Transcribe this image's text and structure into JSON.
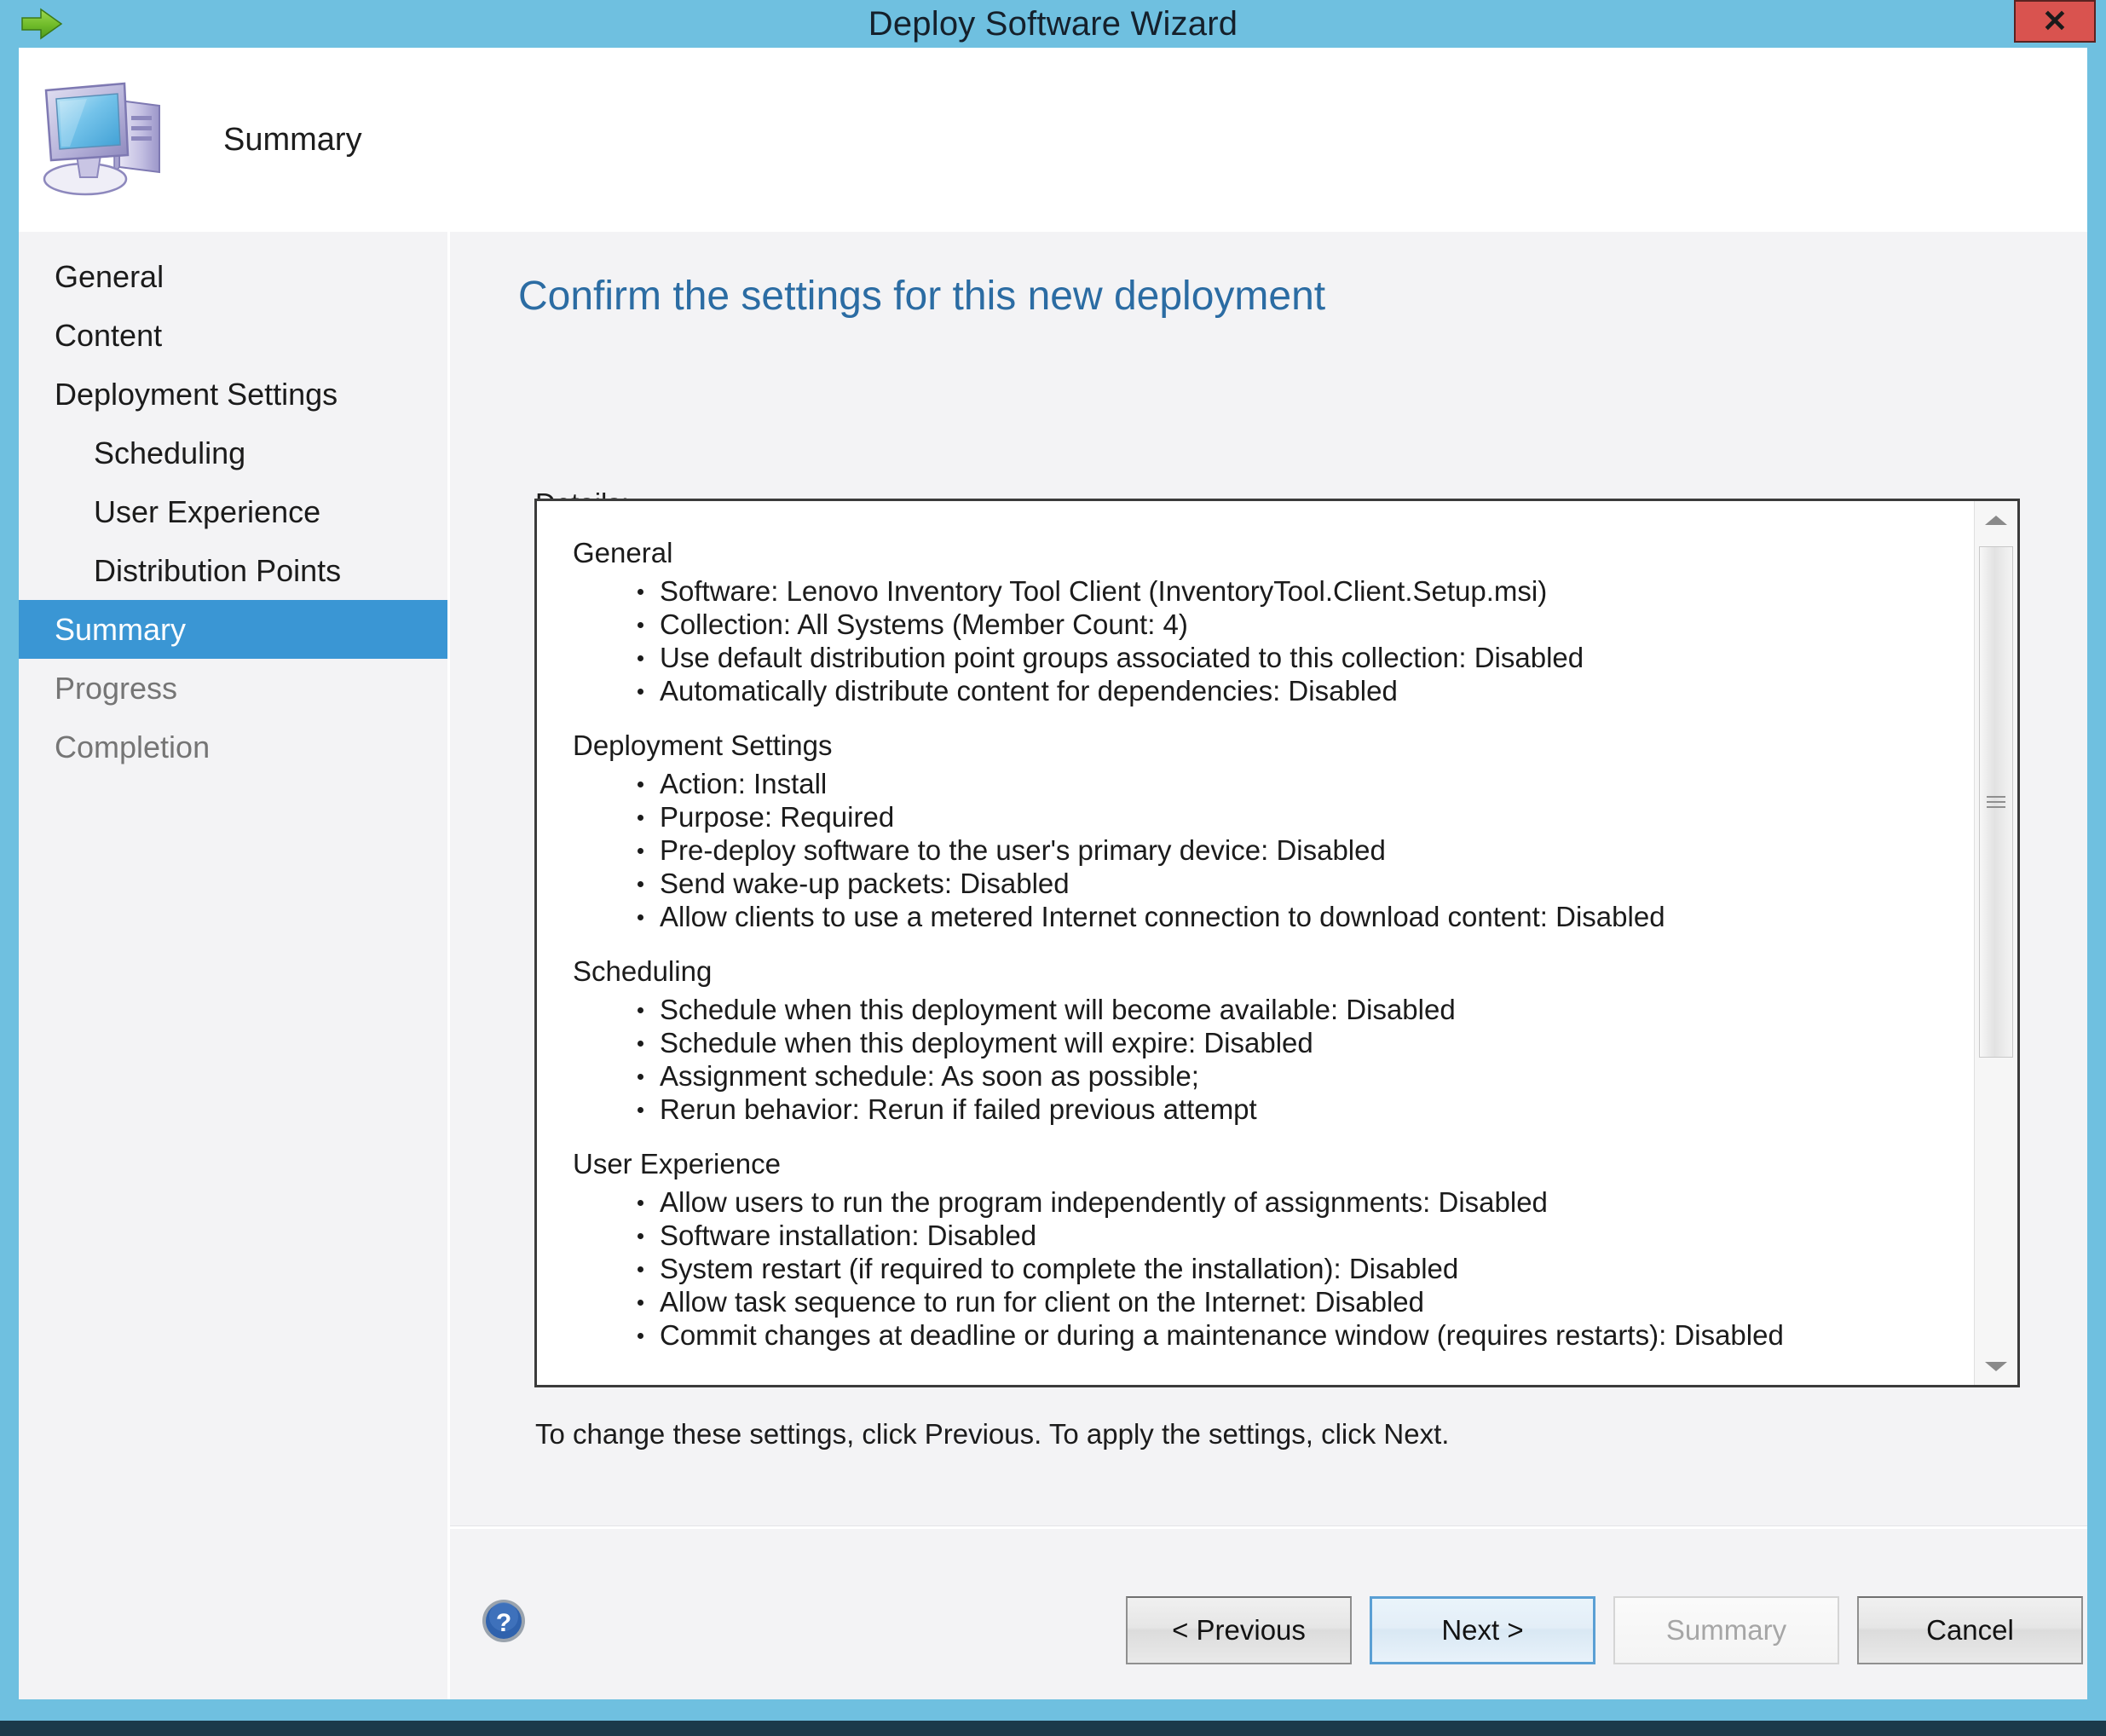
{
  "window": {
    "title": "Deploy Software Wizard",
    "close_label": "✕",
    "back_arrow_icon": "green-right-arrow-icon",
    "accent_color": "#6fc0e0",
    "selection_color": "#3a96d4",
    "heading_color": "#2b6ca3",
    "close_color": "#d9534f"
  },
  "header": {
    "icon": "computer-monitor-icon",
    "title": "Summary"
  },
  "sidebar": {
    "items": [
      {
        "label": "General",
        "indent": false,
        "selected": false,
        "muted": false
      },
      {
        "label": "Content",
        "indent": false,
        "selected": false,
        "muted": false
      },
      {
        "label": "Deployment Settings",
        "indent": false,
        "selected": false,
        "muted": false
      },
      {
        "label": "Scheduling",
        "indent": true,
        "selected": false,
        "muted": false
      },
      {
        "label": "User Experience",
        "indent": true,
        "selected": false,
        "muted": false
      },
      {
        "label": "Distribution Points",
        "indent": true,
        "selected": false,
        "muted": false
      },
      {
        "label": "Summary",
        "indent": false,
        "selected": true,
        "muted": false
      },
      {
        "label": "Progress",
        "indent": false,
        "selected": false,
        "muted": true
      },
      {
        "label": "Completion",
        "indent": false,
        "selected": false,
        "muted": true
      }
    ]
  },
  "content": {
    "heading": "Confirm the settings for this new deployment",
    "details_label": "Details:",
    "hint": "To change these settings, click Previous. To apply the settings, click Next.",
    "sections": [
      {
        "title": "General",
        "items": [
          "Software: Lenovo Inventory Tool Client (InventoryTool.Client.Setup.msi)",
          "Collection: All Systems (Member Count: 4)",
          "Use default distribution point groups associated to this collection: Disabled",
          "Automatically distribute content for dependencies: Disabled"
        ]
      },
      {
        "title": "Deployment Settings",
        "items": [
          "Action: Install",
          "Purpose: Required",
          "Pre-deploy software to the user's primary device: Disabled",
          "Send wake-up packets: Disabled",
          "Allow clients to use a metered Internet connection to download content: Disabled"
        ]
      },
      {
        "title": "Scheduling",
        "items": [
          "Schedule when this deployment will become available: Disabled",
          "Schedule when this deployment will expire: Disabled",
          "Assignment schedule: As soon as possible;",
          "Rerun behavior: Rerun if failed previous attempt"
        ]
      },
      {
        "title": "User Experience",
        "items": [
          "Allow users to run the program independently of assignments: Disabled",
          "Software installation: Disabled",
          "System restart (if required to complete the installation): Disabled",
          "Allow task sequence to run for client on the Internet: Disabled",
          "Commit changes at deadline or during a maintenance window (requires restarts): Disabled"
        ]
      }
    ]
  },
  "scrollbar": {
    "up_icon": "scroll-up-arrow-icon",
    "down_icon": "scroll-down-arrow-icon",
    "thumb_icon": "scrollbar-thumb-grip"
  },
  "footer": {
    "help_icon": "help-question-icon",
    "buttons": {
      "previous": "< Previous",
      "next": "Next >",
      "summary": "Summary",
      "cancel": "Cancel"
    }
  }
}
